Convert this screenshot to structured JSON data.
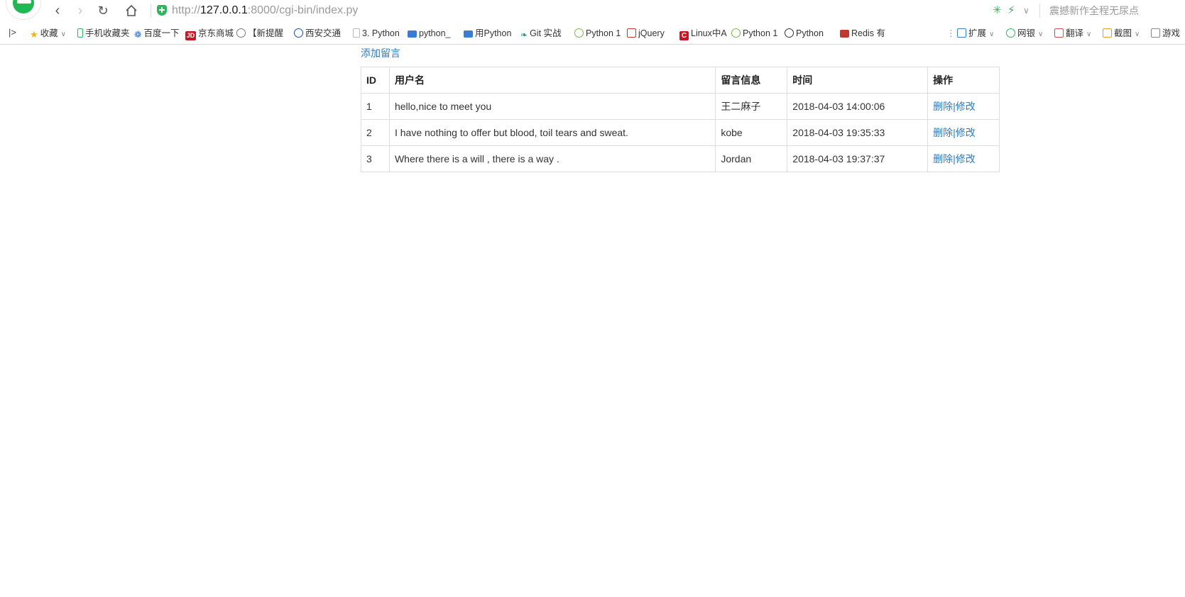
{
  "browser": {
    "url_prefix": "http://",
    "url_host": "127.0.0.1",
    "url_rest": ":8000/cgi-bin/index.py",
    "search_placeholder": "震撼新作全程无尿点",
    "icons": [
      "back-icon",
      "forward-icon",
      "reload-icon",
      "home-icon",
      "shield-icon"
    ]
  },
  "bookmarks": {
    "items": [
      {
        "label": "收藏",
        "icon": "star-icon",
        "color": "#f5b400"
      },
      {
        "label": "手机收藏夹",
        "icon": "phone-icon",
        "color": "#2fb55d"
      },
      {
        "label": "百度一下",
        "icon": "paw-icon",
        "color": "#2a6ee0"
      },
      {
        "label": "京东商城",
        "icon": "jd-icon",
        "color": "#c81623"
      },
      {
        "label": "【新提醒",
        "icon": "swirl-icon",
        "color": "#777777"
      },
      {
        "label": "西安交通",
        "icon": "seal-icon",
        "color": "#1a4f9c"
      },
      {
        "label": "3. Python",
        "icon": "page-icon",
        "color": "#bbbbbb"
      },
      {
        "label": "python_",
        "icon": "book-icon",
        "color": "#3a7bd5"
      },
      {
        "label": "用Python",
        "icon": "book-icon",
        "color": "#3a7bd5"
      },
      {
        "label": "Git 实战",
        "icon": "leaf-icon",
        "color": "#1aa08c"
      },
      {
        "label": "Python 1",
        "icon": "apple-icon",
        "color": "#7ab648"
      },
      {
        "label": "jQuery",
        "icon": "j-icon",
        "color": "#c0392b"
      },
      {
        "label": "Linux中A",
        "icon": "c-icon",
        "color": "#c81623"
      },
      {
        "label": "Python 1",
        "icon": "apple-icon",
        "color": "#7ab648"
      },
      {
        "label": "Python",
        "icon": "gear-icon",
        "color": "#333333"
      },
      {
        "label": "Redis 有",
        "icon": "redis-icon",
        "color": "#c0392b"
      }
    ],
    "right_items": [
      {
        "label": "扩展",
        "icon": "extension-icon",
        "color": "#3a7bd5"
      },
      {
        "label": "网银",
        "icon": "bank-icon",
        "color": "#2fb55d"
      },
      {
        "label": "翻译",
        "icon": "translate-icon",
        "color": "#e04a4a"
      },
      {
        "label": "截图",
        "icon": "screenshot-icon",
        "color": "#e0a030"
      },
      {
        "label": "游戏",
        "icon": "game-icon",
        "color": "#888888"
      }
    ]
  },
  "page": {
    "add_link": "添加留言",
    "table": {
      "headers": [
        "ID",
        "用户名",
        "留言信息",
        "时间",
        "操作"
      ],
      "rows": [
        {
          "id": "1",
          "user": "hello,nice to meet you",
          "message": "王二麻子",
          "time": "2018-04-03 14:00:06"
        },
        {
          "id": "2",
          "user": "I have nothing to offer but blood, toil tears and sweat.",
          "message": "kobe",
          "time": "2018-04-03 19:35:33"
        },
        {
          "id": "3",
          "user": "Where there is a will , there is a way .",
          "message": "Jordan",
          "time": "2018-04-03 19:37:37"
        }
      ],
      "delete_label": "删除",
      "separator": "|",
      "edit_label": "修改"
    }
  }
}
